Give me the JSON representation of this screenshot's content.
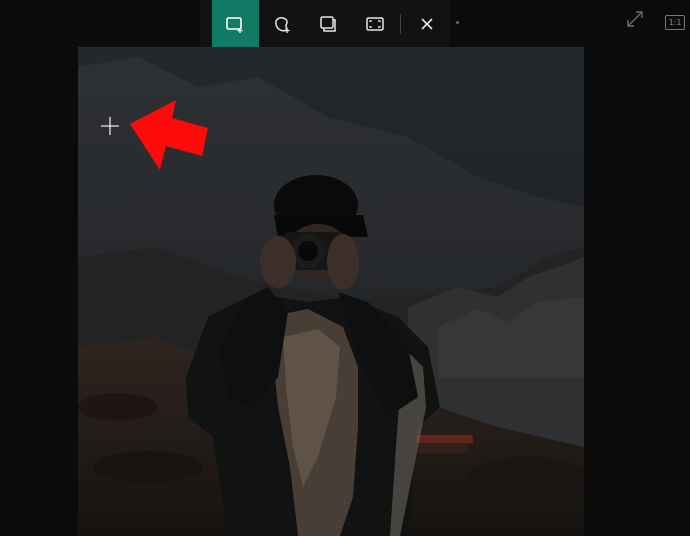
{
  "toolbar": {
    "modes": [
      {
        "name": "rectangle-snip",
        "active": true
      },
      {
        "name": "freeform-snip",
        "active": false
      },
      {
        "name": "window-snip",
        "active": false
      },
      {
        "name": "fullscreen-snip",
        "active": false
      }
    ],
    "close_icon": "close-icon",
    "accent_color": "#117a64"
  },
  "window": {
    "ratio_label": "1:1",
    "expand_icon": "expand-icon"
  },
  "annotation": {
    "arrow_color": "#ff0a0a",
    "cursor_icon": "crosshair-icon"
  }
}
